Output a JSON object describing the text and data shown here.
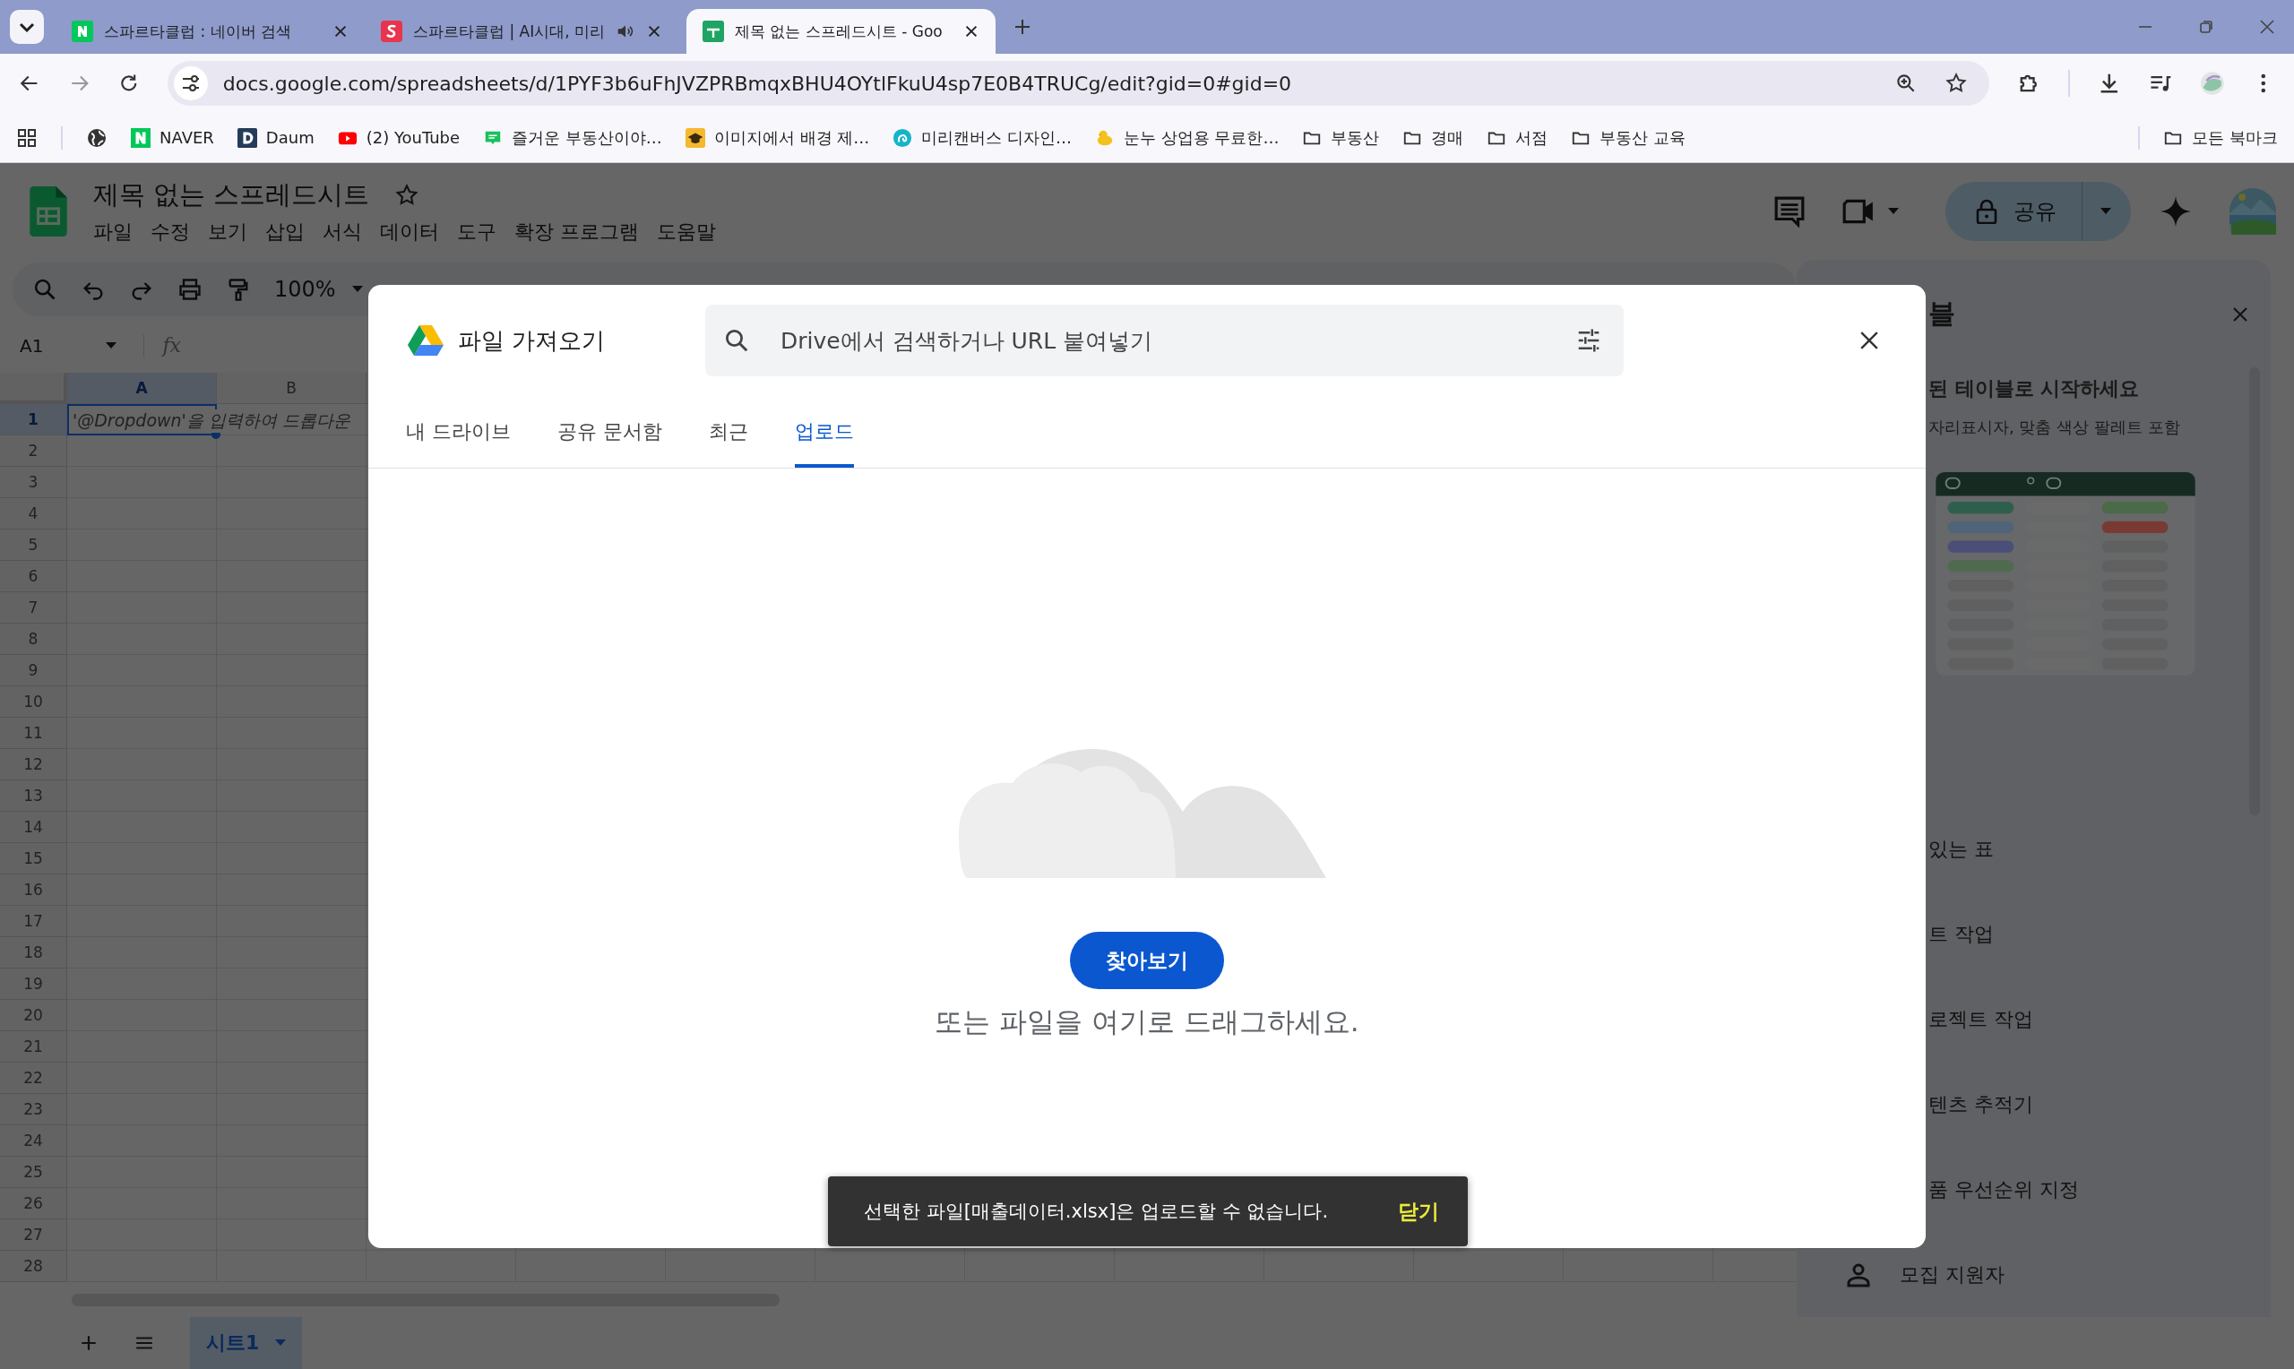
{
  "browser": {
    "tabs": [
      {
        "title": "스파르타클럽 : 네이버 검색",
        "kind": "naver",
        "selected": false,
        "audio": false
      },
      {
        "title": "스파르타클럽 | AI시대, 미리",
        "kind": "sparta",
        "selected": false,
        "audio": true
      },
      {
        "title": "제목 없는 스프레드시트 - Goo",
        "kind": "sheets",
        "selected": true,
        "audio": false
      }
    ],
    "url": "docs.google.com/spreadsheets/d/1PYF3b6uFhJVZPRBmqxBHU4OYtlFkuU4sp7E0B4TRUCg/edit?gid=0#gid=0",
    "bookmarks": [
      {
        "kind": "globe"
      },
      {
        "kind": "naver",
        "label": "NAVER"
      },
      {
        "kind": "daum",
        "label": "Daum"
      },
      {
        "kind": "youtube",
        "label": "(2) YouTube"
      },
      {
        "kind": "blog",
        "label": "즐거운 부동산이야…"
      },
      {
        "kind": "hat",
        "label": "이미지에서 배경 제…"
      },
      {
        "kind": "miri",
        "label": "미리캔버스 디자인…"
      },
      {
        "kind": "duck",
        "label": "눈누 상업용 무료한…"
      },
      {
        "kind": "folder",
        "label": "부동산"
      },
      {
        "kind": "folder",
        "label": "경매"
      },
      {
        "kind": "folder",
        "label": "서점"
      },
      {
        "kind": "folder",
        "label": "부동산 교육"
      }
    ],
    "all_bookmarks": "모든 북마크"
  },
  "sheet": {
    "title": "제목 없는 스프레드시트",
    "menu": [
      "파일",
      "수정",
      "보기",
      "삽입",
      "서식",
      "데이터",
      "도구",
      "확장 프로그램",
      "도움말"
    ],
    "share": "공유",
    "zoom": "100%",
    "name_box": "A1",
    "function_label": "fx",
    "columns": [
      {
        "label": "A",
        "selected": true
      },
      {
        "label": "B",
        "selected": false
      }
    ],
    "rows": [
      {
        "label": "1",
        "selected": true,
        "cell": "'@Dropdown'을 입력하여 드롭다운"
      },
      {
        "label": "2",
        "selected": false
      },
      {
        "label": "3",
        "selected": false
      },
      {
        "label": "4",
        "selected": false
      },
      {
        "label": "5",
        "selected": false
      },
      {
        "label": "6",
        "selected": false
      },
      {
        "label": "7",
        "selected": false
      },
      {
        "label": "8",
        "selected": false
      },
      {
        "label": "9",
        "selected": false
      },
      {
        "label": "10",
        "selected": false
      },
      {
        "label": "11",
        "selected": false
      },
      {
        "label": "12",
        "selected": false
      },
      {
        "label": "13",
        "selected": false
      },
      {
        "label": "14",
        "selected": false
      },
      {
        "label": "15",
        "selected": false
      },
      {
        "label": "16",
        "selected": false
      },
      {
        "label": "17",
        "selected": false
      },
      {
        "label": "18",
        "selected": false
      },
      {
        "label": "19",
        "selected": false
      },
      {
        "label": "20",
        "selected": false
      },
      {
        "label": "21",
        "selected": false
      },
      {
        "label": "22",
        "selected": false
      },
      {
        "label": "23",
        "selected": false
      },
      {
        "label": "24",
        "selected": false
      },
      {
        "label": "25",
        "selected": false
      },
      {
        "label": "26",
        "selected": false
      },
      {
        "label": "27",
        "selected": false
      },
      {
        "label": "28",
        "selected": false
      }
    ],
    "sheet_tabs": [
      {
        "label": "시트1",
        "selected": true
      }
    ]
  },
  "side_panel": {
    "title": "블",
    "heading": "된 테이블로 시작하세요",
    "subtext": "자리표시자, 맞춤 색상 팔레트 포함",
    "items": [
      {
        "label": "있는 표",
        "kind": "plain"
      },
      {
        "label": "트 작업",
        "kind": "plain"
      },
      {
        "label": "로젝트 작업",
        "kind": "plain"
      },
      {
        "label": "텐츠 추적기",
        "kind": "plain"
      },
      {
        "label": "품 우선순위 지정",
        "kind": "plain"
      },
      {
        "label": "모집 지원자",
        "kind": "person"
      }
    ]
  },
  "dialog": {
    "title": "파일 가져오기",
    "search": {
      "placeholder": "Drive에서 검색하거나 URL 붙여넣기"
    },
    "tabs": [
      {
        "label": "내 드라이브",
        "selected": false
      },
      {
        "label": "공유 문서함",
        "selected": false
      },
      {
        "label": "최근",
        "selected": false
      },
      {
        "label": "업로드",
        "selected": true
      }
    ],
    "browse_button": "찾아보기",
    "drop_hint": "또는 파일을 여기로 드래그하세요."
  },
  "snackbar": {
    "message": "선택한 파일[매출데이터.xlsx]은 업로드할 수 없습니다.",
    "action": "닫기"
  }
}
